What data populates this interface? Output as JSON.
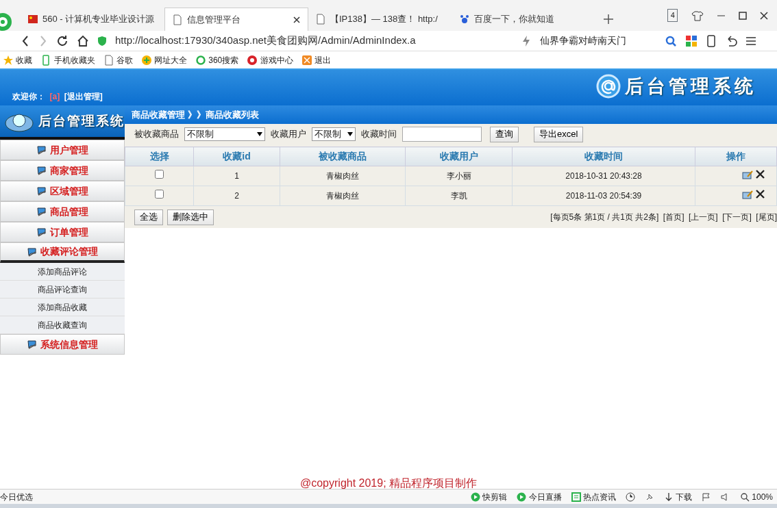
{
  "browser": {
    "tabs": [
      {
        "label": "560 - 计算机专业毕业设计源",
        "selected": false,
        "kind": "flag"
      },
      {
        "label": "信息管理平台",
        "selected": true,
        "kind": "page"
      },
      {
        "label": "【IP138】— 138查！ http:/",
        "selected": false,
        "kind": "page"
      },
      {
        "label": "百度一下，你就知道",
        "selected": false,
        "kind": "paw"
      }
    ],
    "tab_count": "4",
    "address": "http://localhost:17930/340asp.net美食团购网/Admin/AdminIndex.a",
    "search_value": "仙界争霸对峙南天门",
    "bookmarks": [
      {
        "label": "收藏",
        "kind": "star"
      },
      {
        "label": "手机收藏夹",
        "kind": "phone"
      },
      {
        "label": "谷歌",
        "kind": "page"
      },
      {
        "label": "网址大全",
        "kind": "plus"
      },
      {
        "label": "360搜索",
        "kind": "ring"
      },
      {
        "label": "游戏中心",
        "kind": "game"
      },
      {
        "label": "退出",
        "kind": "exit"
      }
    ]
  },
  "page": {
    "header": {
      "welcome": "欢迎你：",
      "user": "[a]",
      "logout": "[退出管理]",
      "logo_text": "后台管理系统"
    },
    "sidebar": {
      "logo_text": "后台管理系统",
      "items": [
        {
          "label": "用户管理",
          "expanded": false
        },
        {
          "label": "商家管理",
          "expanded": false
        },
        {
          "label": "区域管理",
          "expanded": false
        },
        {
          "label": "商品管理",
          "expanded": false
        },
        {
          "label": "订单管理",
          "expanded": false
        },
        {
          "label": "收藏评论管理",
          "expanded": true,
          "children": [
            {
              "label": "添加商品评论"
            },
            {
              "label": "商品评论查询"
            },
            {
              "label": "添加商品收藏"
            },
            {
              "label": "商品收藏查询"
            }
          ]
        },
        {
          "label": "系统信息管理",
          "expanded": false
        }
      ]
    },
    "breadcrumb": "商品收藏管理 》》商品收藏列表",
    "filters": [
      {
        "label": "被收藏商品",
        "kind": "select",
        "value": "不限制"
      },
      {
        "label": "收藏用户",
        "kind": "select",
        "value": "不限制"
      },
      {
        "label": "收藏时间",
        "kind": "input"
      }
    ],
    "filter_buttons": [
      "查询",
      "导出excel"
    ],
    "table": {
      "columns": [
        "选择",
        "收藏id",
        "被收藏商品",
        "收藏用户",
        "收藏时间",
        "操作"
      ],
      "rows": [
        {
          "checked": false,
          "id": "1",
          "product": "青椒肉丝",
          "user": "李小丽",
          "time": "2018-10-31 20:43:28"
        },
        {
          "checked": false,
          "id": "2",
          "product": "青椒肉丝",
          "user": "李凯",
          "time": "2018-11-03 20:54:39"
        }
      ]
    },
    "bulk_buttons": [
      "全选",
      "删除选中"
    ],
    "pagination": {
      "summary": "[每页5条 第1页 / 共1页 共2条]",
      "links": [
        "[首页]",
        "[上一页]",
        "[下一页]",
        "[尾页]"
      ]
    },
    "footer": "@copyright 2019; 精品程序项目制作"
  },
  "status_bar": {
    "left": "今日优选",
    "items": [
      {
        "label": "快剪辑",
        "kind": "play"
      },
      {
        "label": "今日直播",
        "kind": "play"
      },
      {
        "label": "热点资讯",
        "kind": "news"
      },
      {
        "label": "下载",
        "kind": "download"
      }
    ],
    "zoom": "100%"
  }
}
